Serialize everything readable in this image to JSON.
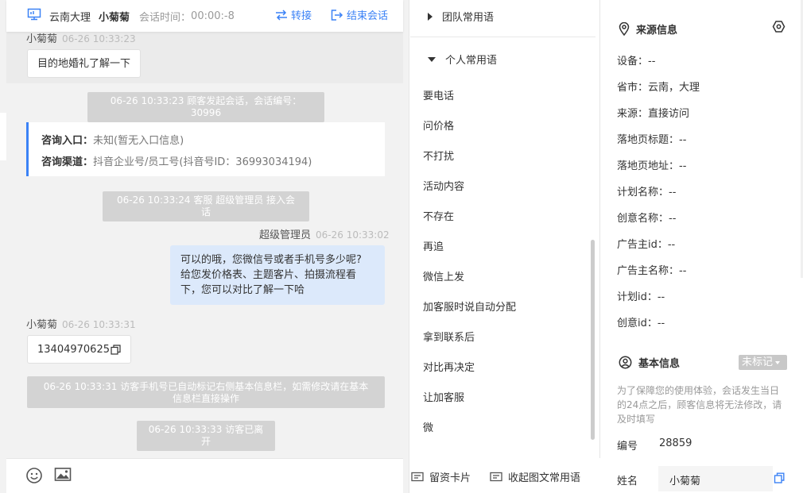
{
  "header": {
    "location": "云南大理",
    "customer_name": "小菊菊",
    "timer_label": "会话时间：",
    "timer_value": "00:00:-8",
    "transfer_label": "转接",
    "end_label": "结束会话"
  },
  "messages": {
    "m1_sender": "小菊菊",
    "m1_time": "06-26 10:33:23",
    "m1_text": "目的地婚礼了解一下",
    "sys1": "06-26 10:33:23 顾客发起会话，会话编号：30996",
    "entry_label": "咨询入口：",
    "entry_value": "未知(暂无入口信息)",
    "channel_label": "咨询渠道：",
    "channel_value": "抖音企业号/员工号(抖音号ID：36993034194)",
    "sys2": "06-26 10:33:24 客服 超级管理员 接入会话",
    "m2_sender": "超级管理员",
    "m2_time": "06-26 10:33:02",
    "m2_line1": "可以的哦，您微信号或者手机号多少呢?",
    "m2_line2": "给您发价格表、主题客片、拍摄流程看",
    "m2_line3": "下，您可以对比了解一下哈",
    "m3_sender": "小菊菊",
    "m3_time": "06-26 10:33:31",
    "m3_text": "13404970625",
    "sys3_line1": "06-26 10:33:31 访客手机号已自动标记右侧基本信息栏，如需修改请在基本",
    "sys3_line2": "信息栏直接操作",
    "sys4": "06-26 10:33:33 访客已离开"
  },
  "phrases": {
    "team_title": "团队常用语",
    "personal_title": "个人常用语",
    "items": [
      "要电话",
      "问价格",
      "不打扰",
      "活动内容",
      "不存在",
      "再追",
      "微信上发",
      "加客服时说自动分配",
      "拿到联系后",
      "对比再决定",
      "让加客服",
      "微"
    ],
    "card_label": "留资卡片",
    "collapse_label": "收起图文常用语"
  },
  "source": {
    "title": "来源信息",
    "fields": [
      "设备：--",
      "省市：云南，大理",
      "来源：直接访问",
      "落地页标题：--",
      "落地页地址：--",
      "计划名称：--",
      "创意名称：--",
      "广告主id：--",
      "广告主名称：--",
      "计划id：--",
      "创意id：--"
    ]
  },
  "basic": {
    "title": "基本信息",
    "tag_label": "未标记",
    "notice": "为了保障您的使用体验，会话发生当日的24点之后，顾客信息将无法修改，请及时填写",
    "id_label": "编号",
    "id_value": "28859",
    "name_label": "姓名",
    "name_value": "小菊菊"
  },
  "colors": {
    "accent": "#3b82f6",
    "my_bubble": "#dce9fb",
    "system_notice": "#d3d3d3"
  }
}
